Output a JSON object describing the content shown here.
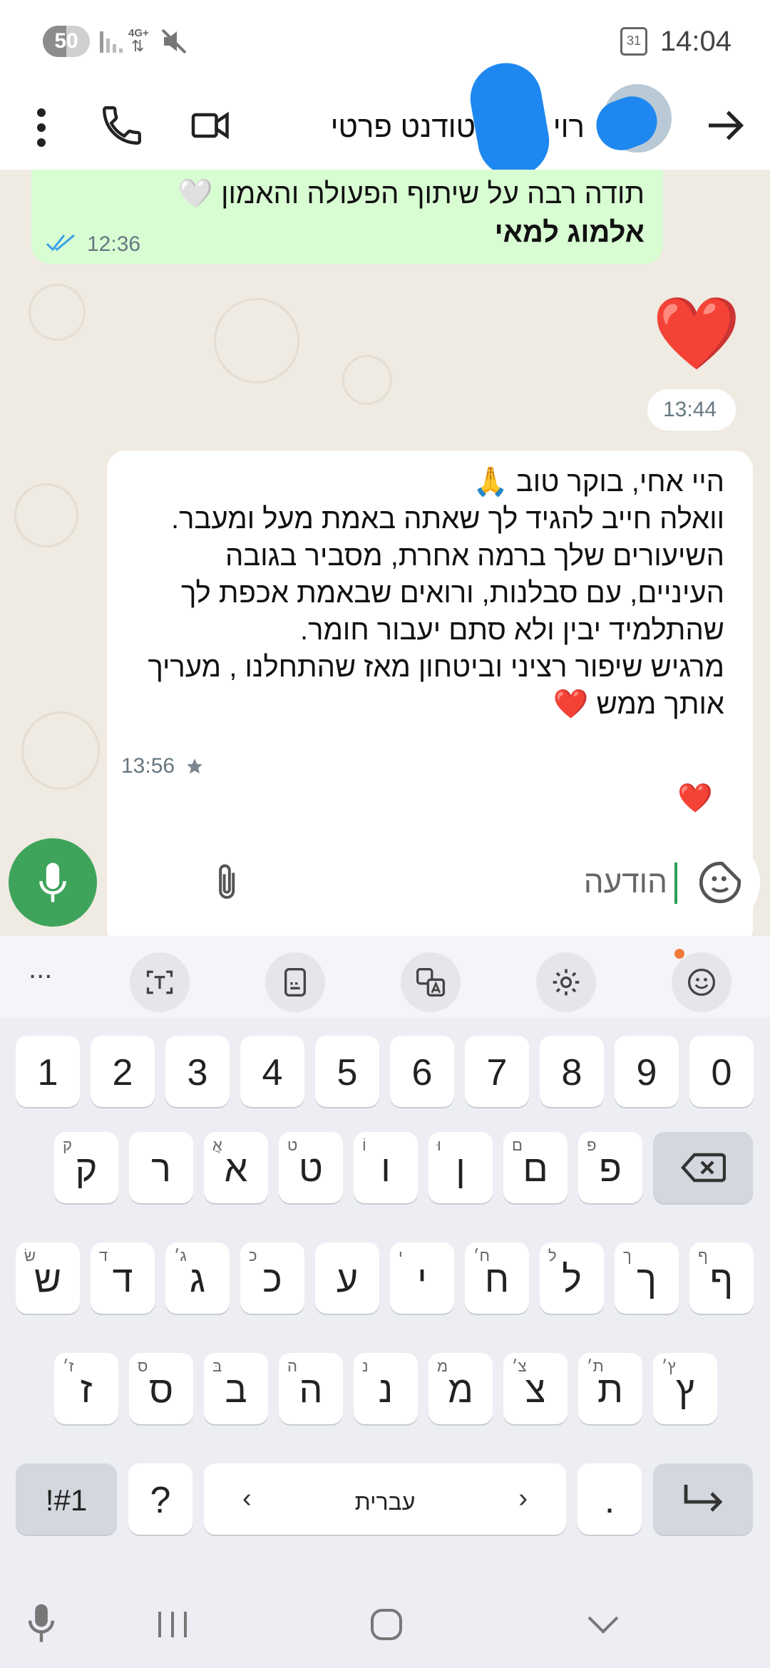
{
  "status_bar": {
    "battery_level": "50",
    "battery_fraction": 0.5,
    "network_label": "4G+",
    "time": "14:04",
    "calendar_day": "31"
  },
  "header": {
    "contact_name": "רוי ריזן סטודנט פרטי"
  },
  "messages": [
    {
      "direction": "outgoing",
      "lines": [
        "תודה רבה על שיתוף הפעולה והאמון 🤍"
      ],
      "bold_line": "אלמוג למאי",
      "time": "12:36",
      "status": "read"
    },
    {
      "direction": "outgoing",
      "emoji": "❤️",
      "time": "13:44"
    },
    {
      "direction": "incoming",
      "lines": [
        "היי אחי, בוקר טוב 🙏",
        "וואלה חייב להגיד לך שאתה באמת מעל ומעבר.",
        "השיעורים שלך ברמה אחרת, מסביר בגובה",
        "העיניים, עם סבלנות, ורואים שבאמת אכפת לך",
        "שהתלמיד יבין ולא סתם יעבור חומר.",
        "מרגיש שיפור רציני וביטחון מאז שהתחלנו , מעריך",
        "אותך ממש ❤️"
      ],
      "time": "13:56",
      "starred": true,
      "reaction": "❤️"
    }
  ],
  "composer": {
    "placeholder": "הודעה"
  },
  "keyboard": {
    "toolbar_more": "...",
    "number_row": [
      "1",
      "2",
      "3",
      "4",
      "5",
      "6",
      "7",
      "8",
      "9",
      "0"
    ],
    "row1": [
      {
        "main": "ק",
        "hint": "ק"
      },
      {
        "main": "ר",
        "hint": ""
      },
      {
        "main": "א",
        "hint": "אֲ"
      },
      {
        "main": "ט",
        "hint": "ט"
      },
      {
        "main": "ו",
        "hint": "וֹ"
      },
      {
        "main": "ן",
        "hint": "וּ"
      },
      {
        "main": "ם",
        "hint": "ם"
      },
      {
        "main": "פ",
        "hint": "פ"
      }
    ],
    "row2": [
      {
        "main": "ש",
        "hint": "שׂ"
      },
      {
        "main": "ד",
        "hint": "ד"
      },
      {
        "main": "ג",
        "hint": "ג׳"
      },
      {
        "main": "כ",
        "hint": "כ"
      },
      {
        "main": "ע",
        "hint": ""
      },
      {
        "main": "י",
        "hint": "י"
      },
      {
        "main": "ח",
        "hint": "ח׳"
      },
      {
        "main": "ל",
        "hint": "ל"
      },
      {
        "main": "ך",
        "hint": "ך"
      },
      {
        "main": "ף",
        "hint": "ף"
      }
    ],
    "row3": [
      {
        "main": "ז",
        "hint": "ז׳"
      },
      {
        "main": "ס",
        "hint": "ס"
      },
      {
        "main": "ב",
        "hint": "בּ"
      },
      {
        "main": "ה",
        "hint": "ה"
      },
      {
        "main": "נ",
        "hint": "נ"
      },
      {
        "main": "מ",
        "hint": "מ"
      },
      {
        "main": "צ",
        "hint": "צ׳"
      },
      {
        "main": "ת",
        "hint": "ת׳"
      },
      {
        "main": "ץ",
        "hint": "ץ׳"
      }
    ],
    "symbols_label": "!#1",
    "question_label": "?",
    "language_label": "עברית",
    "period_label": "."
  }
}
